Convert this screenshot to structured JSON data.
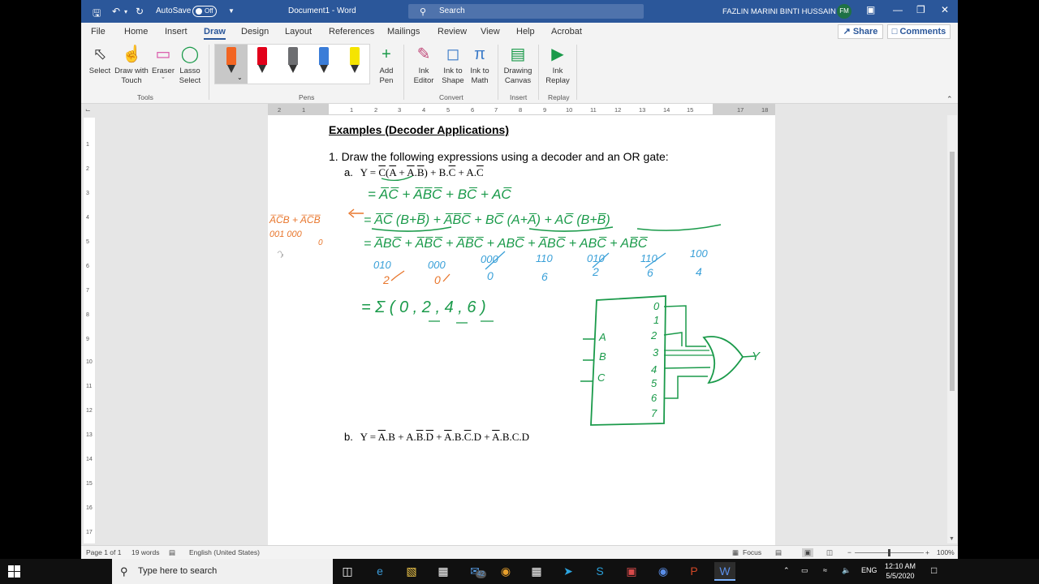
{
  "titlebar": {
    "autosave_label": "AutoSave",
    "autosave_state": "Off",
    "doc_title": "Document1  -  Word",
    "search_placeholder": "Search",
    "user_name": "FAZLIN MARINI BINTI HUSSAIN",
    "user_initials": "FM"
  },
  "tabs": [
    "File",
    "Home",
    "Insert",
    "Draw",
    "Design",
    "Layout",
    "References",
    "Mailings",
    "Review",
    "View",
    "Help",
    "Acrobat"
  ],
  "active_tab": "Draw",
  "share_label": "Share",
  "comments_label": "Comments",
  "ribbon": {
    "tools": {
      "select": "Select",
      "draw_touch_1": "Draw with",
      "draw_touch_2": "Touch",
      "eraser": "Eraser",
      "lasso_1": "Lasso",
      "lasso_2": "Select",
      "group": "Tools"
    },
    "pens_group": "Pens",
    "pen_colors": [
      "#f26522",
      "#e2001a",
      "#6d6e71",
      "#3b7dd8",
      "#f5e400"
    ],
    "add_pen_1": "Add",
    "add_pen_2": "Pen",
    "convert": {
      "ink_editor_1": "Ink",
      "ink_editor_2": "Editor",
      "ink_shape_1": "Ink to",
      "ink_shape_2": "Shape",
      "ink_math_1": "Ink to",
      "ink_math_2": "Math",
      "group": "Convert"
    },
    "insert": {
      "canvas_1": "Drawing",
      "canvas_2": "Canvas",
      "group": "Insert"
    },
    "replay": {
      "replay_1": "Ink",
      "replay_2": "Replay",
      "group": "Replay"
    }
  },
  "hruler_ticks": [
    "2",
    "1",
    "1",
    "2",
    "3",
    "4",
    "5",
    "6",
    "7",
    "8",
    "9",
    "10",
    "11",
    "12",
    "13",
    "14",
    "15",
    "17",
    "18"
  ],
  "vruler_ticks": [
    "1",
    "2",
    "3",
    "4",
    "5",
    "6",
    "7",
    "8",
    "9",
    "10",
    "11",
    "12",
    "13",
    "14",
    "15",
    "16",
    "17"
  ],
  "document": {
    "heading": "Examples (Decoder Applications)",
    "q1": "1.  Draw the following expressions using a decoder and an OR gate:",
    "qa_label": "a.",
    "qb_label": "b."
  },
  "ink": {
    "green": "#1a9a4a",
    "orange": "#e8762c",
    "blue": "#3aa0d8",
    "line1": "= A̅C̅ + A̅B̅C̅ + BC̅ + AC̅",
    "line2": "= A̅C̅ (B+B̅) + A̅B̅C̅ + BC̅ (A+A̅) + AC̅ (B+B̅)",
    "line3": "= A̅BC̅ + A̅B̅C̅ + A̅B̅C̅ + ABC̅ + A̅BC̅ + ABC̅ + AB̅C̅",
    "binaries": [
      "010",
      "000",
      "000",
      "110",
      "010",
      "110",
      "100"
    ],
    "decimals": [
      "2",
      "0",
      "0",
      "6",
      "2",
      "6",
      "4"
    ],
    "sigma": "= Σ ( 0 , 2 , 4 , 6 )",
    "side_note_1": "A̅C̅B + A̅C̅B̅",
    "side_note_2": "001     000",
    "side_note_3": "0",
    "decoder_inputs": [
      "A",
      "B",
      "C"
    ],
    "decoder_outputs": [
      "0",
      "1",
      "2",
      "3",
      "4",
      "5",
      "6",
      "7"
    ],
    "gate_output": "Y"
  },
  "status": {
    "page": "Page 1 of 1",
    "words": "19 words",
    "language": "English (United States)",
    "focus": "Focus",
    "zoom": "100%"
  },
  "taskbar": {
    "search_placeholder": "Type here to search",
    "mail_badge": "42",
    "lang": "ENG",
    "time": "12:10 AM",
    "date": "5/5/2020"
  }
}
